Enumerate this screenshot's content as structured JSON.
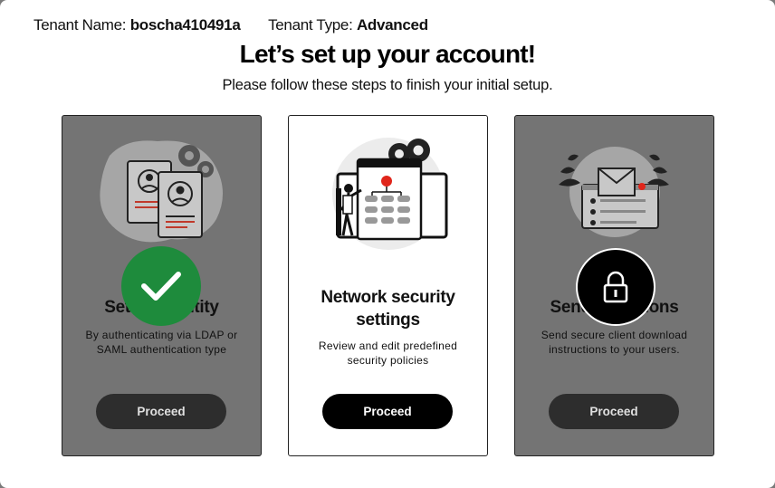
{
  "tenant": {
    "name_label": "Tenant Name:",
    "name_value": "boscha410491a",
    "type_label": "Tenant Type:",
    "type_value": "Advanced"
  },
  "header": {
    "title": "Let’s set up your account!",
    "subtitle": "Please follow these steps to finish your initial setup."
  },
  "cards": [
    {
      "title": "Set up identity",
      "description": "By authenticating via LDAP or SAML authentication type",
      "button": "Proceed",
      "status": "completed",
      "status_icon": "checkmark-icon"
    },
    {
      "title": "Network security settings",
      "description": "Review and edit predefined security policies",
      "button": "Proceed",
      "status": "active"
    },
    {
      "title": "Send invitations",
      "description": "Send secure client download instructions to your users.",
      "button": "Proceed",
      "status": "locked",
      "status_icon": "lock-icon"
    }
  ],
  "colors": {
    "accent_red": "#e0261b",
    "success_green": "#1e8b3c",
    "disabled_card": "#747474",
    "button_black": "#000000"
  }
}
